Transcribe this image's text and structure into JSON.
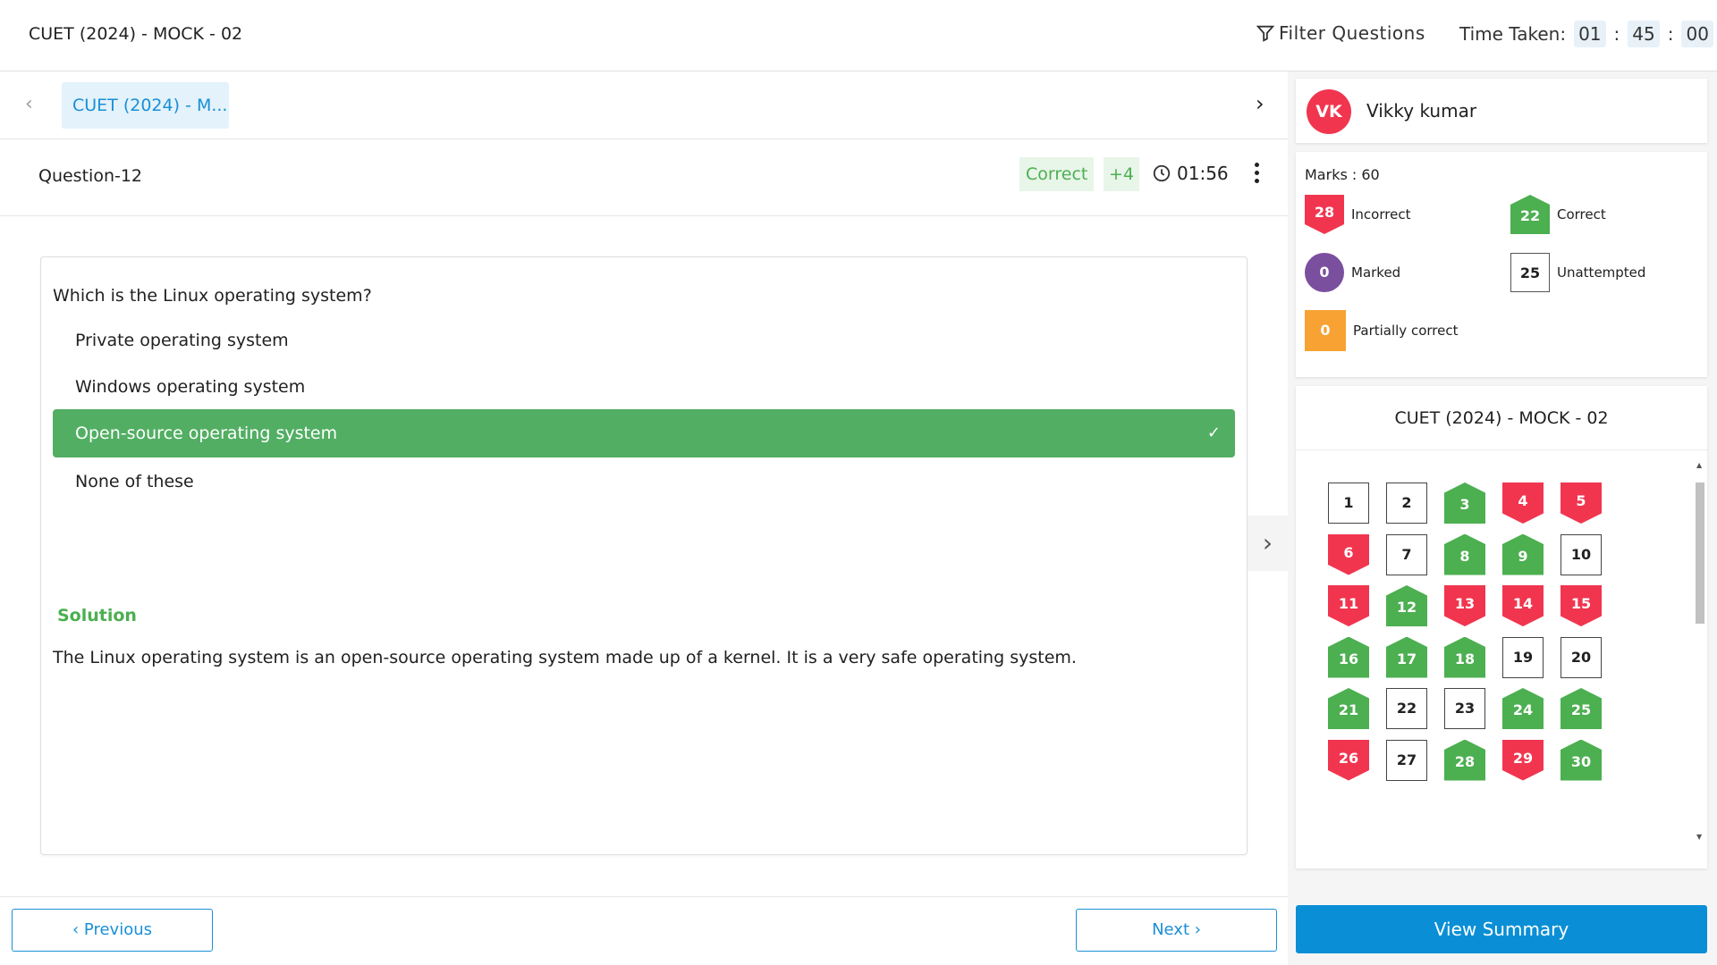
{
  "topbar": {
    "title": "CUET (2024) - MOCK - 02",
    "filter_label": "Filter Questions",
    "time_label": "Time Taken:",
    "time_h": "01",
    "time_m": "45",
    "time_s": "00",
    "time_sep": ":"
  },
  "section": {
    "prev_icon": "‹",
    "tab_label": "CUET (2024) - M...",
    "next_icon": "›"
  },
  "question": {
    "number_label": "Question-12",
    "status": "Correct",
    "marks": "+4",
    "time": "01:56",
    "text": "Which is the Linux operating system?",
    "options": [
      "Private operating system",
      "Windows operating system",
      "Open-source operating system",
      "None of these"
    ],
    "check_icon": "✓",
    "solution_title": "Solution",
    "solution_text": "The Linux operating system is an open-source operating system made up of a kernel. It is a very safe operating system."
  },
  "footer": {
    "prev_label": "‹  Previous",
    "next_label": "Next  ›"
  },
  "side_arrow": "›",
  "user": {
    "initials": "VK",
    "name": "Vikky kumar"
  },
  "stats": {
    "marks_label": "Marks : 60",
    "incorrect": "28",
    "incorrect_label": "Incorrect",
    "correct": "22",
    "correct_label": "Correct",
    "marked": "0",
    "marked_label": "Marked",
    "unattempted": "25",
    "unattempted_label": "Unattempted",
    "partial": "0",
    "partial_label": "Partially correct"
  },
  "palette": {
    "title": "CUET (2024) - MOCK - 02",
    "questions": [
      {
        "n": "1",
        "s": "na"
      },
      {
        "n": "2",
        "s": "na"
      },
      {
        "n": "3",
        "s": "c"
      },
      {
        "n": "4",
        "s": "i"
      },
      {
        "n": "5",
        "s": "i"
      },
      {
        "n": "6",
        "s": "i"
      },
      {
        "n": "7",
        "s": "na"
      },
      {
        "n": "8",
        "s": "c"
      },
      {
        "n": "9",
        "s": "c"
      },
      {
        "n": "10",
        "s": "na"
      },
      {
        "n": "11",
        "s": "i"
      },
      {
        "n": "12",
        "s": "c"
      },
      {
        "n": "13",
        "s": "i"
      },
      {
        "n": "14",
        "s": "i"
      },
      {
        "n": "15",
        "s": "i"
      },
      {
        "n": "16",
        "s": "c"
      },
      {
        "n": "17",
        "s": "c"
      },
      {
        "n": "18",
        "s": "c"
      },
      {
        "n": "19",
        "s": "na"
      },
      {
        "n": "20",
        "s": "na"
      },
      {
        "n": "21",
        "s": "c"
      },
      {
        "n": "22",
        "s": "na"
      },
      {
        "n": "23",
        "s": "na"
      },
      {
        "n": "24",
        "s": "c"
      },
      {
        "n": "25",
        "s": "c"
      },
      {
        "n": "26",
        "s": "i"
      },
      {
        "n": "27",
        "s": "na"
      },
      {
        "n": "28",
        "s": "c"
      },
      {
        "n": "29",
        "s": "i"
      },
      {
        "n": "30",
        "s": "c"
      }
    ],
    "scroll_up": "▲",
    "scroll_down": "▼"
  },
  "summary_label": "View Summary",
  "colors": {
    "accent": "#1a8fd6",
    "correct": "#4caf50",
    "incorrect": "#f1354f",
    "marked": "#7a4f9e",
    "partial": "#f7a233"
  }
}
